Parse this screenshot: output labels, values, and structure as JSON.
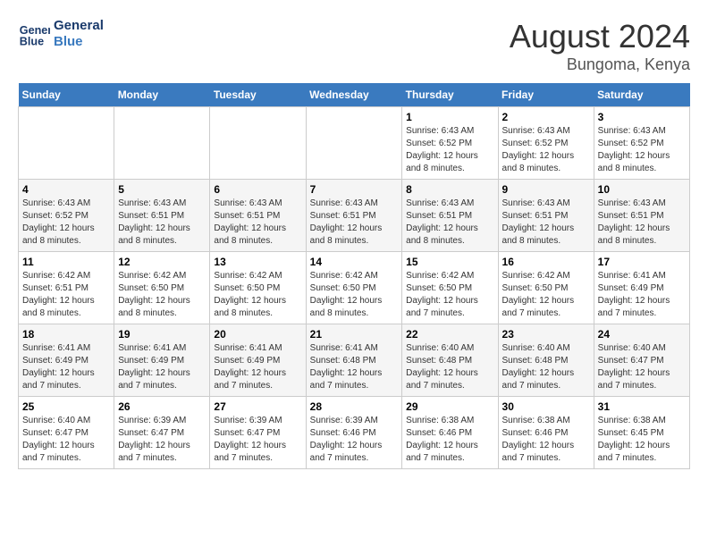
{
  "logo": {
    "line1": "General",
    "line2": "Blue"
  },
  "title": "August 2024",
  "subtitle": "Bungoma, Kenya",
  "days_of_week": [
    "Sunday",
    "Monday",
    "Tuesday",
    "Wednesday",
    "Thursday",
    "Friday",
    "Saturday"
  ],
  "weeks": [
    [
      {
        "day": "",
        "info": ""
      },
      {
        "day": "",
        "info": ""
      },
      {
        "day": "",
        "info": ""
      },
      {
        "day": "",
        "info": ""
      },
      {
        "day": "1",
        "info": "Sunrise: 6:43 AM\nSunset: 6:52 PM\nDaylight: 12 hours and 8 minutes."
      },
      {
        "day": "2",
        "info": "Sunrise: 6:43 AM\nSunset: 6:52 PM\nDaylight: 12 hours and 8 minutes."
      },
      {
        "day": "3",
        "info": "Sunrise: 6:43 AM\nSunset: 6:52 PM\nDaylight: 12 hours and 8 minutes."
      }
    ],
    [
      {
        "day": "4",
        "info": "Sunrise: 6:43 AM\nSunset: 6:52 PM\nDaylight: 12 hours and 8 minutes."
      },
      {
        "day": "5",
        "info": "Sunrise: 6:43 AM\nSunset: 6:51 PM\nDaylight: 12 hours and 8 minutes."
      },
      {
        "day": "6",
        "info": "Sunrise: 6:43 AM\nSunset: 6:51 PM\nDaylight: 12 hours and 8 minutes."
      },
      {
        "day": "7",
        "info": "Sunrise: 6:43 AM\nSunset: 6:51 PM\nDaylight: 12 hours and 8 minutes."
      },
      {
        "day": "8",
        "info": "Sunrise: 6:43 AM\nSunset: 6:51 PM\nDaylight: 12 hours and 8 minutes."
      },
      {
        "day": "9",
        "info": "Sunrise: 6:43 AM\nSunset: 6:51 PM\nDaylight: 12 hours and 8 minutes."
      },
      {
        "day": "10",
        "info": "Sunrise: 6:43 AM\nSunset: 6:51 PM\nDaylight: 12 hours and 8 minutes."
      }
    ],
    [
      {
        "day": "11",
        "info": "Sunrise: 6:42 AM\nSunset: 6:51 PM\nDaylight: 12 hours and 8 minutes."
      },
      {
        "day": "12",
        "info": "Sunrise: 6:42 AM\nSunset: 6:50 PM\nDaylight: 12 hours and 8 minutes."
      },
      {
        "day": "13",
        "info": "Sunrise: 6:42 AM\nSunset: 6:50 PM\nDaylight: 12 hours and 8 minutes."
      },
      {
        "day": "14",
        "info": "Sunrise: 6:42 AM\nSunset: 6:50 PM\nDaylight: 12 hours and 8 minutes."
      },
      {
        "day": "15",
        "info": "Sunrise: 6:42 AM\nSunset: 6:50 PM\nDaylight: 12 hours and 7 minutes."
      },
      {
        "day": "16",
        "info": "Sunrise: 6:42 AM\nSunset: 6:50 PM\nDaylight: 12 hours and 7 minutes."
      },
      {
        "day": "17",
        "info": "Sunrise: 6:41 AM\nSunset: 6:49 PM\nDaylight: 12 hours and 7 minutes."
      }
    ],
    [
      {
        "day": "18",
        "info": "Sunrise: 6:41 AM\nSunset: 6:49 PM\nDaylight: 12 hours and 7 minutes."
      },
      {
        "day": "19",
        "info": "Sunrise: 6:41 AM\nSunset: 6:49 PM\nDaylight: 12 hours and 7 minutes."
      },
      {
        "day": "20",
        "info": "Sunrise: 6:41 AM\nSunset: 6:49 PM\nDaylight: 12 hours and 7 minutes."
      },
      {
        "day": "21",
        "info": "Sunrise: 6:41 AM\nSunset: 6:48 PM\nDaylight: 12 hours and 7 minutes."
      },
      {
        "day": "22",
        "info": "Sunrise: 6:40 AM\nSunset: 6:48 PM\nDaylight: 12 hours and 7 minutes."
      },
      {
        "day": "23",
        "info": "Sunrise: 6:40 AM\nSunset: 6:48 PM\nDaylight: 12 hours and 7 minutes."
      },
      {
        "day": "24",
        "info": "Sunrise: 6:40 AM\nSunset: 6:47 PM\nDaylight: 12 hours and 7 minutes."
      }
    ],
    [
      {
        "day": "25",
        "info": "Sunrise: 6:40 AM\nSunset: 6:47 PM\nDaylight: 12 hours and 7 minutes."
      },
      {
        "day": "26",
        "info": "Sunrise: 6:39 AM\nSunset: 6:47 PM\nDaylight: 12 hours and 7 minutes."
      },
      {
        "day": "27",
        "info": "Sunrise: 6:39 AM\nSunset: 6:47 PM\nDaylight: 12 hours and 7 minutes."
      },
      {
        "day": "28",
        "info": "Sunrise: 6:39 AM\nSunset: 6:46 PM\nDaylight: 12 hours and 7 minutes."
      },
      {
        "day": "29",
        "info": "Sunrise: 6:38 AM\nSunset: 6:46 PM\nDaylight: 12 hours and 7 minutes."
      },
      {
        "day": "30",
        "info": "Sunrise: 6:38 AM\nSunset: 6:46 PM\nDaylight: 12 hours and 7 minutes."
      },
      {
        "day": "31",
        "info": "Sunrise: 6:38 AM\nSunset: 6:45 PM\nDaylight: 12 hours and 7 minutes."
      }
    ]
  ],
  "header_bg": "#3a7abf",
  "accent_color": "#1a3a6b"
}
